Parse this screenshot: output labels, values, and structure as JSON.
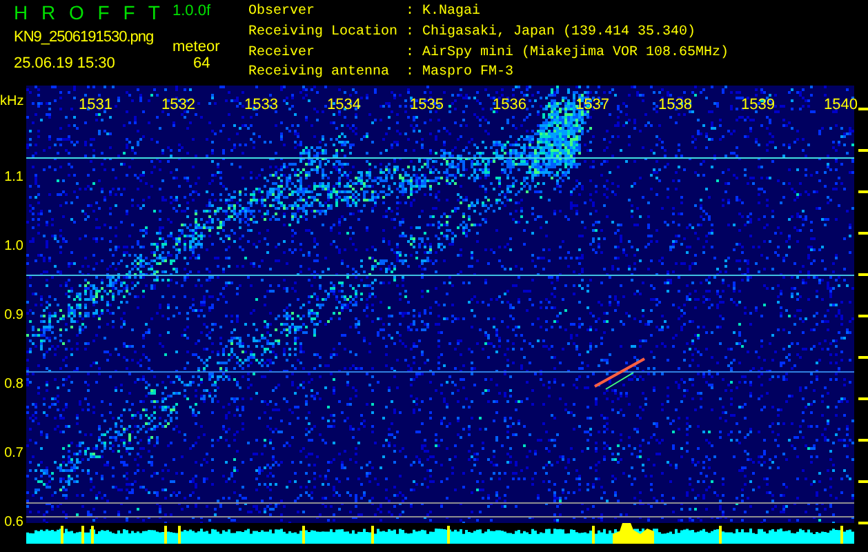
{
  "header": {
    "program": "H R O F F T",
    "version": "1.0.0f",
    "filename": "KN9_2506191530.png",
    "mode": "meteor",
    "datetime": "25.06.19 15:30",
    "count": "64"
  },
  "station_info": [
    {
      "label": "Observer",
      "separator": ":",
      "value": "K.Nagai"
    },
    {
      "label": "Receiving Location",
      "separator": ":",
      "value": "Chigasaki, Japan (139.414 35.340)"
    },
    {
      "label": "Receiver",
      "separator": ":",
      "value": "AirSpy mini (Miakejima VOR 108.65MHz)"
    },
    {
      "label": "Receiving antenna",
      "separator": ":",
      "value": "Maspro FM-3"
    }
  ],
  "spectrogram": {
    "y_unit": "kHz",
    "x_labels": [
      "1531",
      "1532",
      "1533",
      "1534",
      "1535",
      "1536",
      "1537",
      "1538",
      "1539",
      "1540"
    ],
    "y_labels": [
      "1.1",
      "1.0",
      "0.9",
      "0.8",
      "0.7",
      "0.6"
    ]
  }
}
